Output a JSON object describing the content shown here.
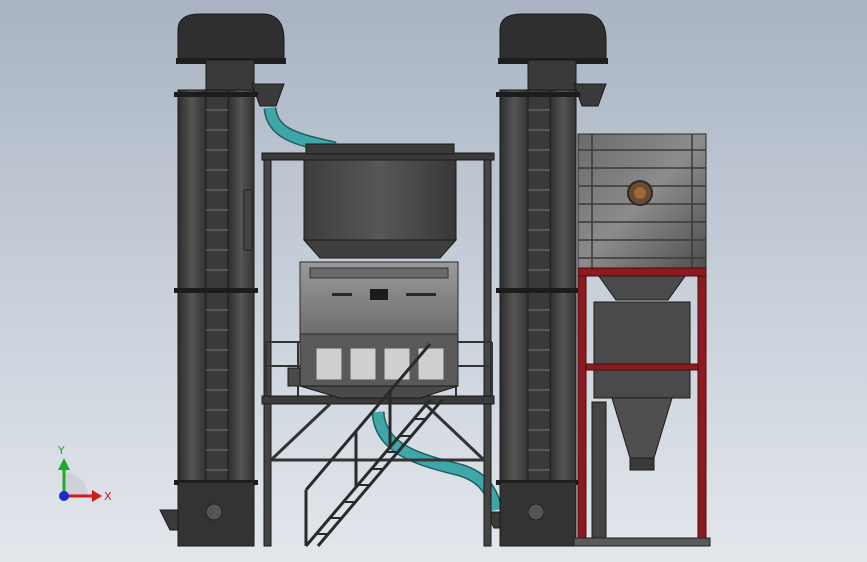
{
  "triad": {
    "y_label": "Y",
    "x_label": "X",
    "y_color": "#1faa2b",
    "x_color": "#d11a1a",
    "z_color": "#1a2ad1"
  },
  "colors": {
    "steel": "#4a4a4a",
    "steel_dark": "#2b2b2b",
    "pipe": "#3fa7a8",
    "frame_red": "#8c1a1e",
    "sorter_body": "#8b8b8b"
  },
  "icons": [
    "elevator-left",
    "elevator-right",
    "transfer-pipe",
    "color-sorter",
    "storage-hopper",
    "support-platform",
    "staircase",
    "silo-bin",
    "red-support-frame",
    "coordinate-triad"
  ]
}
